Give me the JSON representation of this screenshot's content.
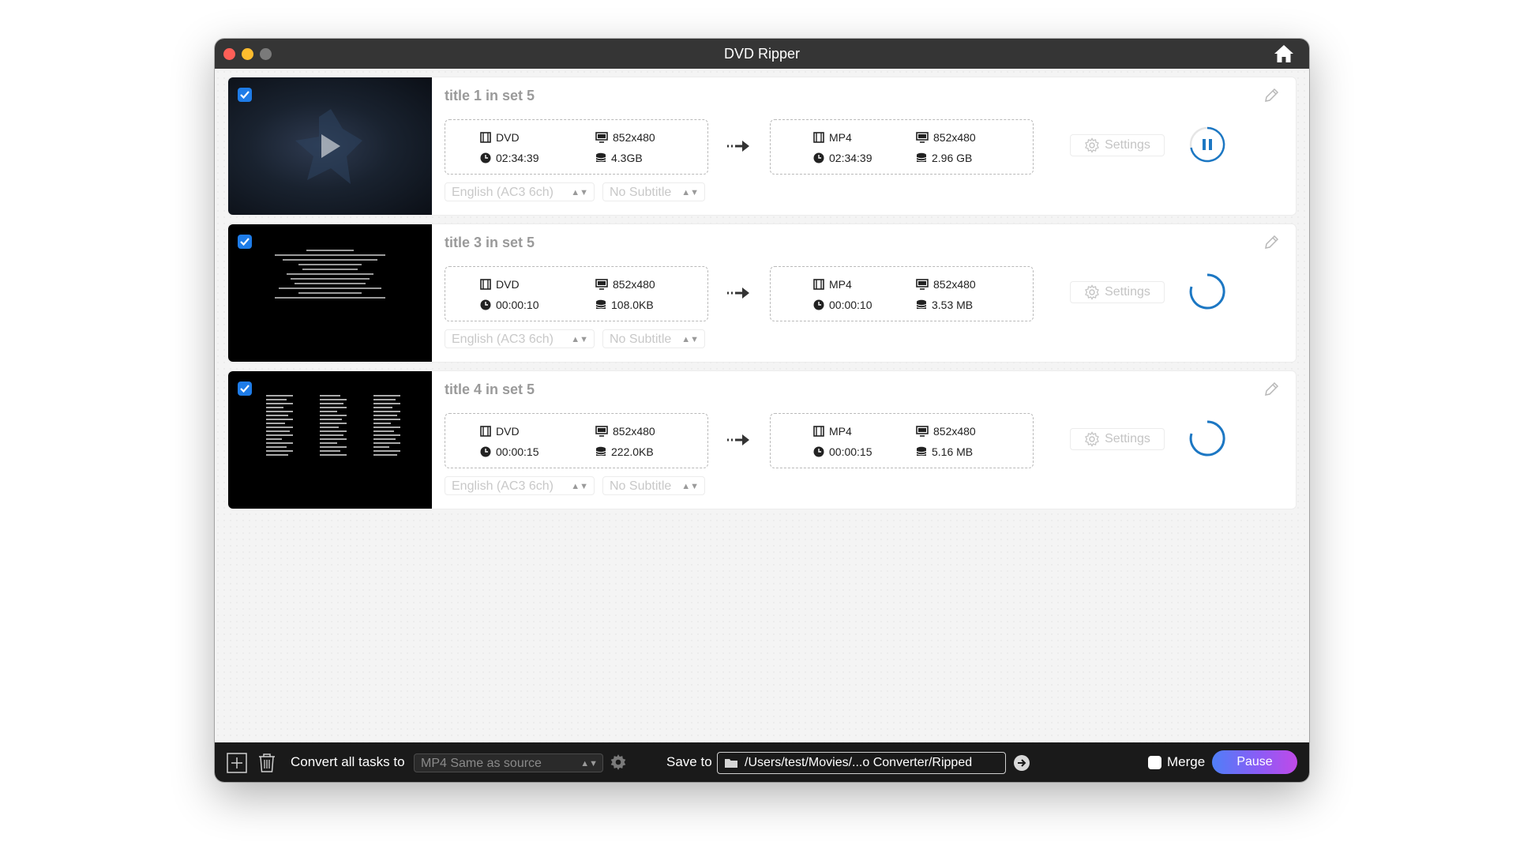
{
  "window": {
    "title": "DVD Ripper",
    "home_icon": "home-icon"
  },
  "common": {
    "settings_label": "Settings",
    "audio_placeholder": "English (AC3 6ch)",
    "subtitle_placeholder": "No Subtitle"
  },
  "tasks": [
    {
      "title": "title 1 in set 5",
      "checked": true,
      "status": "paused-in-progress",
      "source": {
        "format": "DVD",
        "resolution": "852x480",
        "duration": "02:34:39",
        "size": "4.3GB"
      },
      "output": {
        "format": "MP4",
        "resolution": "852x480",
        "duration": "02:34:39",
        "size": "2.96 GB"
      }
    },
    {
      "title": "title 3 in set 5",
      "checked": true,
      "status": "loading",
      "source": {
        "format": "DVD",
        "resolution": "852x480",
        "duration": "00:00:10",
        "size": "108.0KB"
      },
      "output": {
        "format": "MP4",
        "resolution": "852x480",
        "duration": "00:00:10",
        "size": "3.53 MB"
      }
    },
    {
      "title": "title 4 in set 5",
      "checked": true,
      "status": "loading",
      "source": {
        "format": "DVD",
        "resolution": "852x480",
        "duration": "00:00:15",
        "size": "222.0KB"
      },
      "output": {
        "format": "MP4",
        "resolution": "852x480",
        "duration": "00:00:15",
        "size": "5.16 MB"
      }
    }
  ],
  "bottom": {
    "convert_label": "Convert all tasks to",
    "format_value": "MP4 Same as source",
    "save_label": "Save to",
    "save_path": "/Users/test/Movies/...o Converter/Ripped",
    "merge_label": "Merge",
    "merge_checked": false,
    "pause_label": "Pause"
  },
  "colors": {
    "accent_blue": "#1e7ce8",
    "pause_gradient_start": "#4f7ff7",
    "pause_gradient_end": "#c04ae8",
    "titlebar": "#353535",
    "bottombar": "#1a1a1a"
  }
}
